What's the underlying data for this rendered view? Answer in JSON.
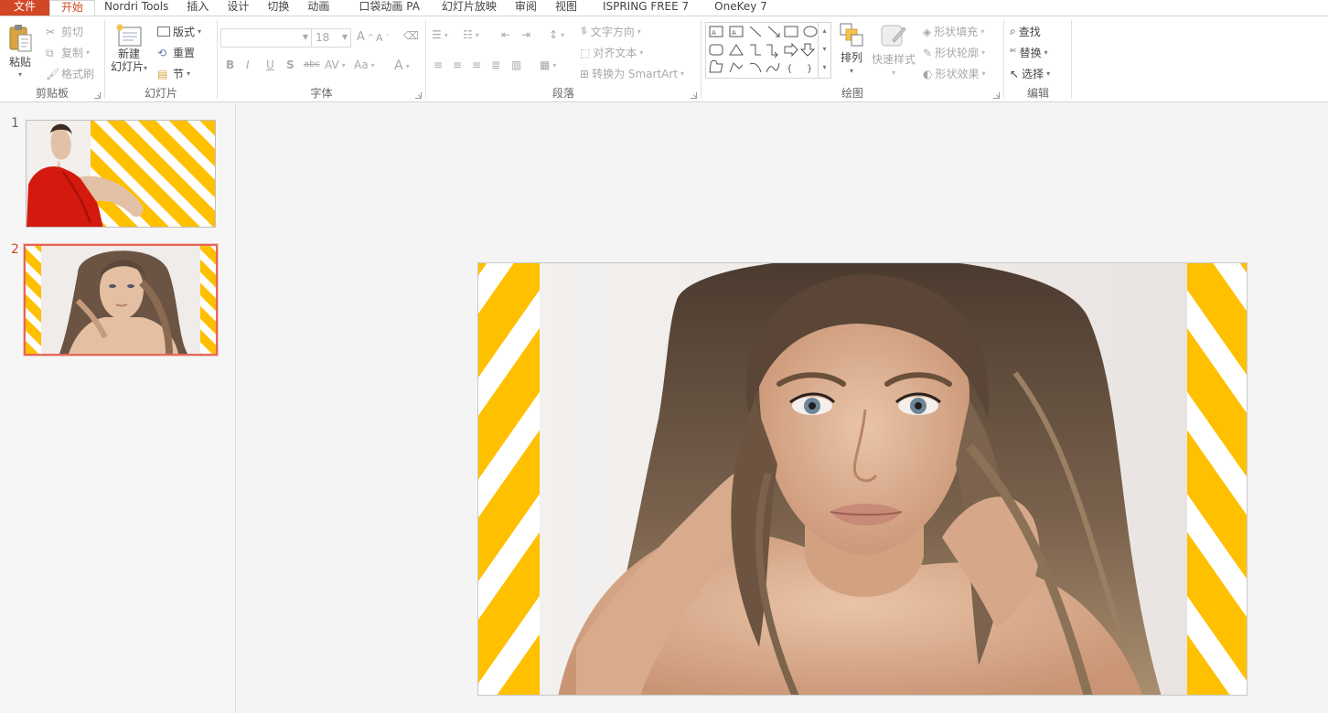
{
  "tabs": [
    "文件",
    "开始",
    "Nordri Tools",
    "插入",
    "设计",
    "切换",
    "动画",
    "口袋动画 PA",
    "幻灯片放映",
    "审阅",
    "视图",
    "ISPRING FREE 7",
    "OneKey 7"
  ],
  "active_tab": "开始",
  "ribbon": {
    "clipboard": {
      "label": "剪贴板",
      "paste": "粘贴",
      "cut": "剪切",
      "copy": "复制",
      "format_painter": "格式刷"
    },
    "slides": {
      "label": "幻灯片",
      "new_slide_line1": "新建",
      "new_slide_line2": "幻灯片",
      "layout": "版式",
      "reset": "重置",
      "section": "节"
    },
    "font": {
      "label": "字体",
      "font_name": "",
      "font_size": "18",
      "bold": "B",
      "italic": "I",
      "underline": "U",
      "shadow": "S",
      "strike": "abc",
      "spacing": "AV",
      "case": "Aa",
      "color": "A",
      "grow": "A",
      "shrink": "A"
    },
    "paragraph": {
      "label": "段落",
      "text_direction": "文字方向",
      "align_text": "对齐文本",
      "smartart": "转换为 SmartArt"
    },
    "drawing": {
      "label": "绘图",
      "arrange": "排列",
      "quick_styles": "快速样式",
      "shape_fill": "形状填充",
      "shape_outline": "形状轮廓",
      "shape_effects": "形状效果"
    },
    "editing": {
      "label": "编辑",
      "find": "查找",
      "replace": "替换",
      "select": "选择"
    }
  },
  "slides": [
    {
      "number": "1",
      "selected": false
    },
    {
      "number": "2",
      "selected": true
    }
  ],
  "colors": {
    "accent": "#d24726",
    "stripe_yellow": "#ffc000",
    "selection": "#e7665a"
  }
}
